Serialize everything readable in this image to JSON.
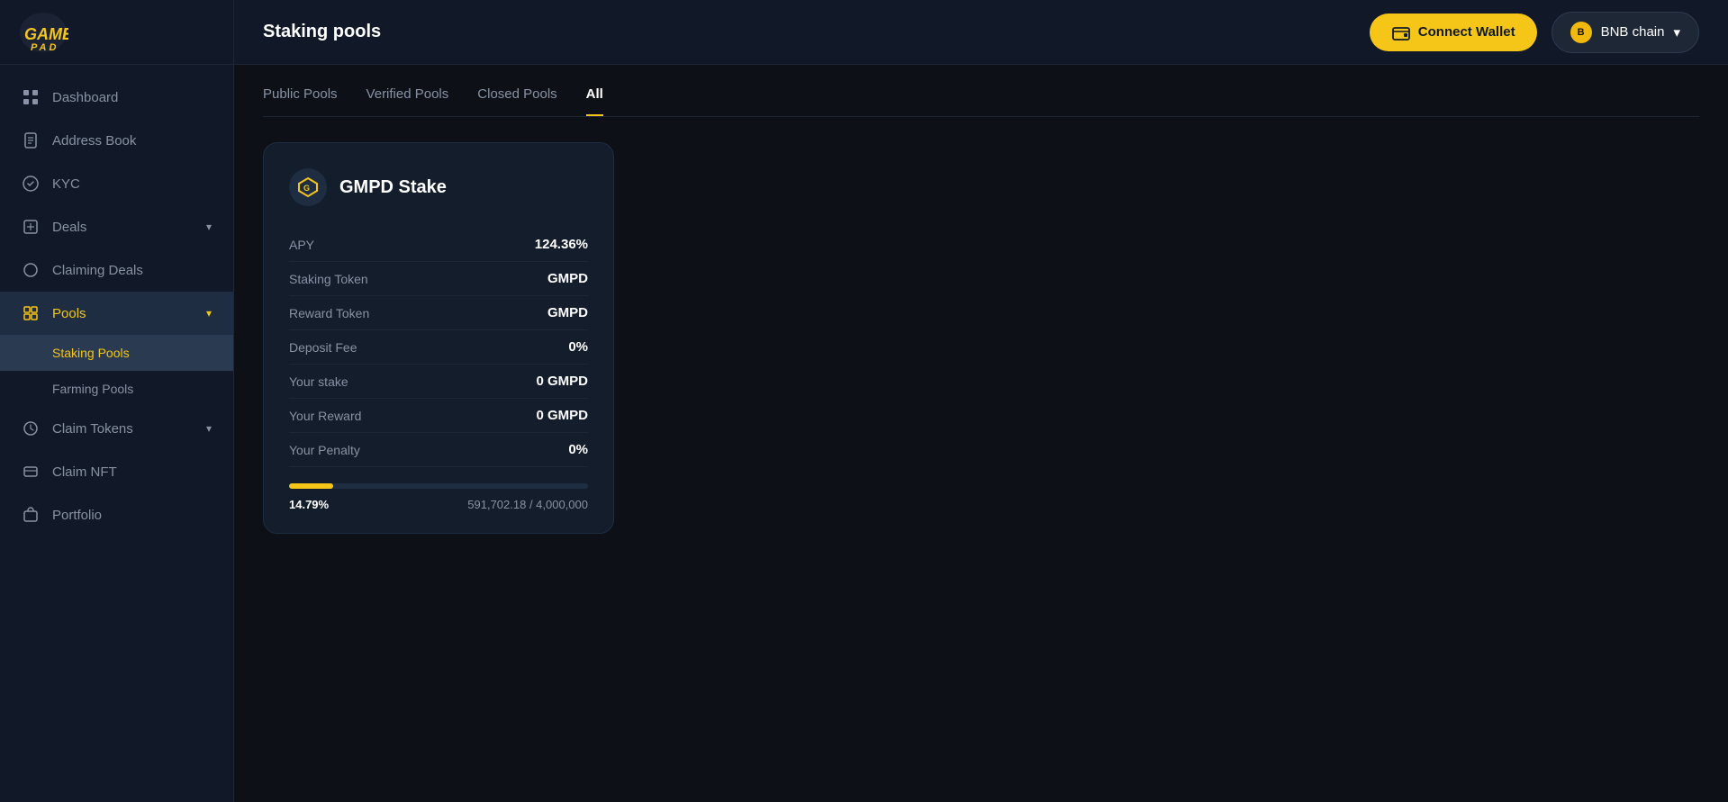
{
  "app": {
    "title": "GamesPad"
  },
  "topbar": {
    "page_title": "Staking pools",
    "connect_wallet_label": "Connect Wallet",
    "chain_label": "BNB chain"
  },
  "tabs": [
    {
      "label": "Public Pools",
      "active": false
    },
    {
      "label": "Verified Pools",
      "active": false
    },
    {
      "label": "Closed Pools",
      "active": false
    },
    {
      "label": "All",
      "active": true
    }
  ],
  "sidebar": {
    "items": [
      {
        "label": "Dashboard",
        "icon": "grid",
        "active": false,
        "has_children": false
      },
      {
        "label": "Address Book",
        "icon": "book",
        "active": false,
        "has_children": false
      },
      {
        "label": "KYC",
        "icon": "shield",
        "active": false,
        "has_children": false
      },
      {
        "label": "Deals",
        "icon": "tag",
        "active": false,
        "has_children": true
      },
      {
        "label": "Claiming Deals",
        "icon": "circle",
        "active": false,
        "has_children": false
      },
      {
        "label": "Pools",
        "icon": "box",
        "active": true,
        "has_children": true
      },
      {
        "label": "Staking Pools",
        "sub": true,
        "active": true
      },
      {
        "label": "Farming Pools",
        "sub": true,
        "active": false
      },
      {
        "label": "Claim Tokens",
        "icon": "download",
        "active": false,
        "has_children": true
      },
      {
        "label": "Claim NFT",
        "icon": "layers",
        "active": false,
        "has_children": false
      },
      {
        "label": "Portfolio",
        "icon": "briefcase",
        "active": false,
        "has_children": false
      }
    ]
  },
  "pool": {
    "name": "GMPD Stake",
    "apy_label": "APY",
    "apy_value": "124.36%",
    "staking_token_label": "Staking Token",
    "staking_token_value": "GMPD",
    "reward_token_label": "Reward Token",
    "reward_token_value": "GMPD",
    "deposit_fee_label": "Deposit Fee",
    "deposit_fee_value": "0%",
    "your_stake_label": "Your stake",
    "your_stake_value": "0 GMPD",
    "your_reward_label": "Your Reward",
    "your_reward_value": "0 GMPD",
    "your_penalty_label": "Your Penalty",
    "your_penalty_value": "0%",
    "progress_pct": "14.79%",
    "progress_fill": 14.79,
    "progress_current": "591,702.18",
    "progress_total": "4,000,000",
    "progress_display": "591,702.18 / 4,000,000"
  },
  "icons": {
    "grid": "▦",
    "book": "📖",
    "shield": "🛡",
    "tag": "🏷",
    "circle": "○",
    "box": "□",
    "download": "⬇",
    "layers": "◫",
    "briefcase": "💼",
    "wallet": "💳",
    "chevron_down": "▾"
  }
}
